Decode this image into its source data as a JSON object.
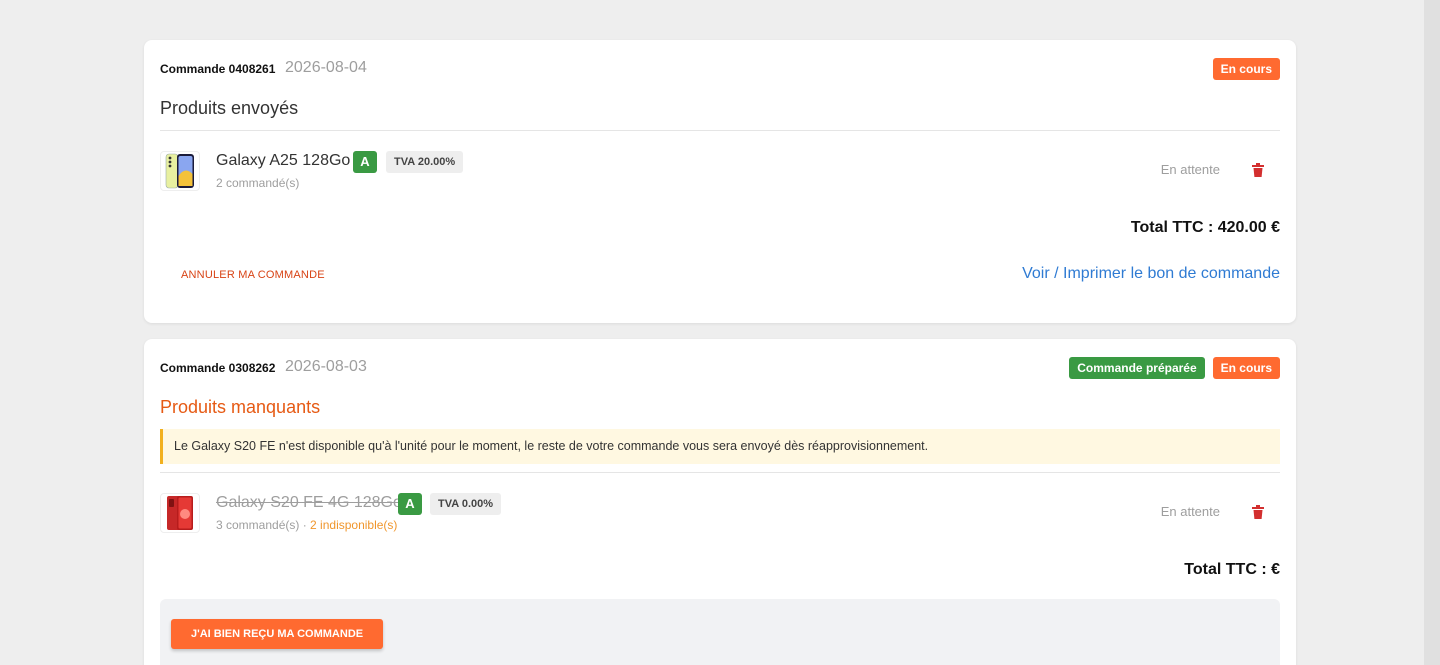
{
  "orders": [
    {
      "number_label": "Commande 0408261",
      "date": "2026-08-04",
      "badges": [
        {
          "label": "En cours",
          "color": "#ff6a30"
        }
      ],
      "section_title": "Produits envoyés",
      "products": [
        {
          "name": "Galaxy A25 128Go",
          "grade": "A",
          "tva": "TVA 20.00%",
          "qty_text": "2 commandé(s)",
          "status": "En attente",
          "icon": "phone-yellow-icon"
        }
      ],
      "total_text": "Total TTC : 420.00 €",
      "cancel_label": "Annuler ma commande",
      "print_label": "Voir / Imprimer le bon de commande"
    },
    {
      "number_label": "Commande 0308262",
      "date": "2026-08-03",
      "badges": [
        {
          "label": "Commande préparée",
          "color": "#3a9a43"
        },
        {
          "label": "En cours",
          "color": "#ff6a30"
        }
      ],
      "section_title": "Produits manquants",
      "alert": "Le Galaxy S20 FE n'est disponible qu'à l'unité pour le moment, le reste de votre commande vous sera envoyé dès réapprovisionnement.",
      "products": [
        {
          "name": "Galaxy S20 FE 4G 128Go",
          "grade": "A",
          "tva": "TVA 0.00%",
          "qty_text": "3 commandé(s)",
          "separator": " · ",
          "missing_text": "2 indisponible(s)",
          "status": "En attente",
          "icon": "phone-red-icon"
        }
      ],
      "total_text": "Total TTC : €",
      "receive_label": "J'ai bien reçu ma commande"
    }
  ]
}
